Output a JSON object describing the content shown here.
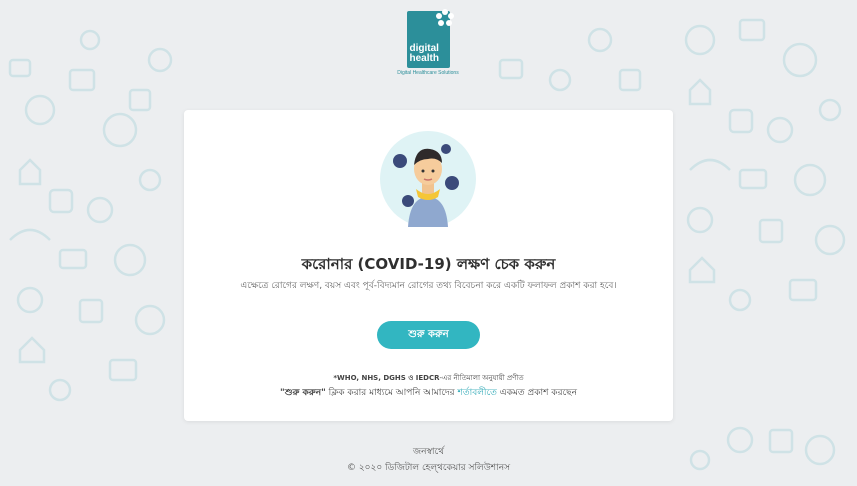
{
  "logo": {
    "line1": "digital",
    "line2": "health",
    "tagline": "Digital Healthcare Solutions"
  },
  "card": {
    "title": "করোনার (COVID-19) লক্ষণ চেক করুন",
    "description": "এক্ষেত্রে রোগের লক্ষণ, বয়স এবং পূর্ব-বিদ্যমান রোগের তথ্য বিবেচনা করে একটি ফলাফল প্রকাশ করা হবে।",
    "start_button": "শুরু করুন",
    "guideline_bold": "*WHO, NHS, DGHS ও IEDCR",
    "guideline_rest": "-এর নীতিমালা অনুযায়ী প্রণীত",
    "consent_quote": "\"শুরু করুন\"",
    "consent_mid": " ক্লিক করার মাধ্যমে আপনি আমাদের ",
    "consent_link": "শর্তাবলীতে",
    "consent_end": " একমত প্রকাশ করছেন"
  },
  "footer": {
    "line1": "জনস্বার্থে",
    "line2": "© ২০২০ ডিজিটাল হেল্থকেয়ার সলিউশানস"
  },
  "colors": {
    "brand": "#2c8f9a",
    "button": "#32b6c1",
    "link": "#2aa7b5",
    "background": "#eceef0"
  }
}
